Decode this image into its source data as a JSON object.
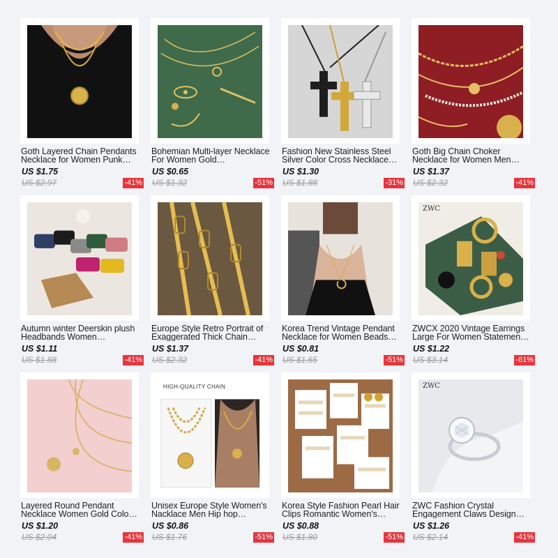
{
  "products": [
    {
      "title": "Goth Layered Chain Pendants Necklace for Women Punk…",
      "price": "US $1.75",
      "original_price": "US $2.97",
      "discount": "-41%",
      "image_icon": "gold-layered-necklace-image"
    },
    {
      "title": "Bohemian Multi-layer Necklace For Women Gold…",
      "price": "US $0.65",
      "original_price": "US $1.32",
      "discount": "-51%",
      "image_icon": "bohemian-necklace-image"
    },
    {
      "title": "Fashion New Stainless Steel Silver Color Cross Necklace…",
      "price": "US $1.30",
      "original_price": "US $1.88",
      "discount": "-31%",
      "image_icon": "cross-pendant-image"
    },
    {
      "title": "Goth Big Chain Choker Necklace for Women Men…",
      "price": "US $1.37",
      "original_price": "US $2.32",
      "discount": "-41%",
      "image_icon": "chain-choker-image"
    },
    {
      "title": "Autumn winter Deerskin plush Headbands Women…",
      "price": "US $1.11",
      "original_price": "US $1.88",
      "discount": "-41%",
      "image_icon": "headbands-image"
    },
    {
      "title": "Europe Style Retro Portrait of Exaggerated Thick Chain…",
      "price": "US $1.37",
      "original_price": "US $2.32",
      "discount": "-41%",
      "image_icon": "thick-chain-image"
    },
    {
      "title": "Korea Trend Vintage Pendant Necklace for Women Beads…",
      "price": "US $0.81",
      "original_price": "US $1.65",
      "discount": "-51%",
      "image_icon": "moon-pendant-image"
    },
    {
      "title": "ZWCX 2020 Vintage Earrings Large For Women Statemen…",
      "price": "US $1.22",
      "original_price": "US $3.14",
      "discount": "-61%",
      "image_icon": "earrings-image",
      "brand": "ZWC"
    },
    {
      "title": "Layered Round Pendant Necklace Women Gold Colo…",
      "price": "US $1.20",
      "original_price": "US $2.04",
      "discount": "-41%",
      "image_icon": "round-pendant-image"
    },
    {
      "title": "Unisex Europe Style Women's Nacklace Men Hip hop…",
      "price": "US $0.86",
      "original_price": "US $1.76",
      "discount": "-51%",
      "image_icon": "hiphop-necklace-image",
      "banner": "HIGH-QUALITY CHAIN"
    },
    {
      "title": "Korea Style Fashion Pearl Hair Clips Romantic Women's…",
      "price": "US $0.88",
      "original_price": "US $1.80",
      "discount": "-51%",
      "image_icon": "hair-clips-image"
    },
    {
      "title": "ZWC Fashion Crystal Engagement Claws Design…",
      "price": "US $1.26",
      "original_price": "US $2.14",
      "discount": "-41%",
      "image_icon": "crystal-ring-image",
      "brand": "ZWC"
    }
  ],
  "colors": {
    "discount_badge": "#e8343c",
    "page_bg": "#f2f3f7"
  }
}
